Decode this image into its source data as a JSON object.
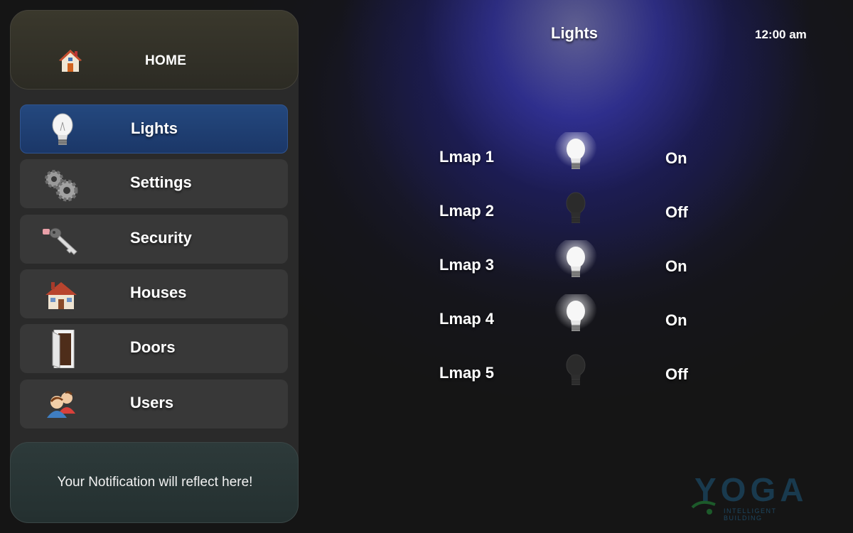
{
  "home": {
    "label": "HOME",
    "icon": "home-icon"
  },
  "menu": [
    {
      "label": "Lights",
      "icon": "lightbulb-icon",
      "active": true
    },
    {
      "label": "Settings",
      "icon": "gears-icon",
      "active": false
    },
    {
      "label": "Security",
      "icon": "key-icon",
      "active": false
    },
    {
      "label": "Houses",
      "icon": "house-icon",
      "active": false
    },
    {
      "label": "Doors",
      "icon": "door-icon",
      "active": false
    },
    {
      "label": "Users",
      "icon": "users-icon",
      "active": false
    }
  ],
  "notification": {
    "text": "Your Notification will reflect here!"
  },
  "header": {
    "title": "Lights",
    "time": "12:00 am"
  },
  "lamps": [
    {
      "name": "Lmap 1",
      "state": "On",
      "on": true
    },
    {
      "name": "Lmap 2",
      "state": "Off",
      "on": false
    },
    {
      "name": "Lmap 3",
      "state": "On",
      "on": true
    },
    {
      "name": "Lmap 4",
      "state": "On",
      "on": true
    },
    {
      "name": "Lmap 5",
      "state": "Off",
      "on": false
    }
  ],
  "brand": {
    "name": "YOGA",
    "tagline": "INTELLIGENT BUILDING"
  },
  "colors": {
    "accent": "#24487e",
    "background": "#161616",
    "glow": "#3c3cbe"
  }
}
